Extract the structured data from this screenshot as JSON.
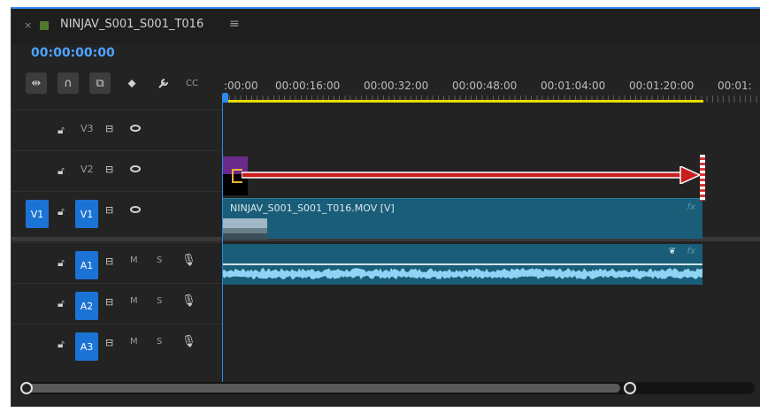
{
  "sequence": {
    "tab_close": "×",
    "tab_name": "NINJAV_S001_S001_T016",
    "tab_menu": "≡",
    "timecode": "00:00:00:00",
    "accent_color": "#2d8ceb"
  },
  "toolbar": {
    "items": [
      {
        "name": "insert-edit-icon",
        "glyph": "⇹"
      },
      {
        "name": "snap-magnet-icon",
        "glyph": "∩"
      },
      {
        "name": "linked-selection-icon",
        "glyph": "⧉"
      },
      {
        "name": "add-marker-icon",
        "glyph": "⬥"
      },
      {
        "name": "settings-wrench-icon",
        "glyph": "🔧"
      },
      {
        "name": "captions-icon",
        "glyph": "CC"
      }
    ]
  },
  "ruler": {
    "labels": [
      ":00:00",
      "00:00:16:00",
      "00:00:32:00",
      "00:00:48:00",
      "00:01:04:00",
      "00:01:20:00",
      "00:01:"
    ]
  },
  "tracks": {
    "v3": {
      "name": "V3",
      "sync": "⊟"
    },
    "v2": {
      "name": "V2",
      "sync": "⊟"
    },
    "v1": {
      "source": "V1",
      "name": "V1",
      "sync": "⊟"
    },
    "a1": {
      "name": "A1",
      "sync": "⊟",
      "mute": "M",
      "solo": "S"
    },
    "a2": {
      "name": "A2",
      "sync": "⊟",
      "mute": "M",
      "solo": "S"
    },
    "a3": {
      "name": "A3",
      "sync": "⊟",
      "mute": "M",
      "solo": "S"
    }
  },
  "clips": {
    "video_name": "NINJAV_S001_S001_T016.MOV [V]",
    "fx": "fx",
    "keyframe": "❦"
  }
}
